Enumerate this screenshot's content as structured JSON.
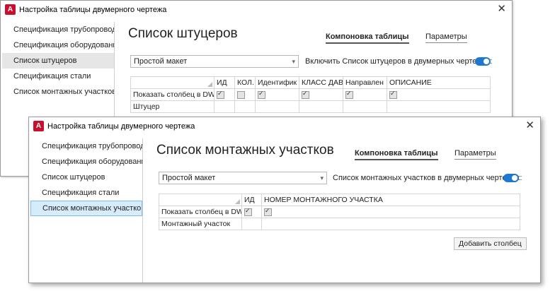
{
  "window1": {
    "title": "Настройка таблицы двумерного чертежа",
    "app_icon_letter": "A",
    "sidebar": [
      "Спецификация трубопровода",
      "Спецификация оборудования",
      "Список штуцеров",
      "Спецификация стали",
      "Список монтажных участков"
    ],
    "selected_index": 2,
    "heading": "Список штуцеров",
    "tab_active": "Компоновка таблицы",
    "tab_inactive": "Параметры",
    "dropdown_value": "Простой макет",
    "include_label": "Включить  Список штуцеров  в двумерных чертежах:",
    "toggle_on": true,
    "grid": {
      "columns": [
        "ИД",
        "КОЛ.",
        "Идентифик",
        "КЛАСС ДАВЛ",
        "Направлен",
        "ОПИСАНИЕ"
      ],
      "row_show_label": "Показать столбец в DWG",
      "row_show_checks": [
        true,
        false,
        true,
        true,
        true,
        true
      ],
      "row_name": "Штуцер"
    }
  },
  "window2": {
    "title": "Настройка таблицы двумерного чертежа",
    "app_icon_letter": "A",
    "sidebar": [
      "Спецификация трубопровода",
      "Спецификация оборудования",
      "Список штуцеров",
      "Спецификация стали",
      "Список монтажных участков"
    ],
    "selected_index": 4,
    "heading": "Список монтажных участков",
    "tab_active": "Компоновка таблицы",
    "tab_inactive": "Параметры",
    "dropdown_value": "Простой макет",
    "include_label": "Список монтажных участков  в двумерных чертежах:",
    "toggle_on": true,
    "grid": {
      "columns": [
        "ИД",
        "НОМЕР МОНТАЖНОГО УЧАСТКА"
      ],
      "row_show_label": "Показать столбец в DWG",
      "row_show_checks": [
        true,
        true
      ],
      "row_name": "Монтажный участок"
    },
    "add_column_button": "Добавить столбец"
  },
  "icons": {
    "app": "autocad-plant-icon",
    "close": "close-icon",
    "dropdown": "chevron-down-icon"
  },
  "colors": {
    "accent": "#1e78d2",
    "app_icon": "#c8102e",
    "selection": "#d7ecfb"
  }
}
